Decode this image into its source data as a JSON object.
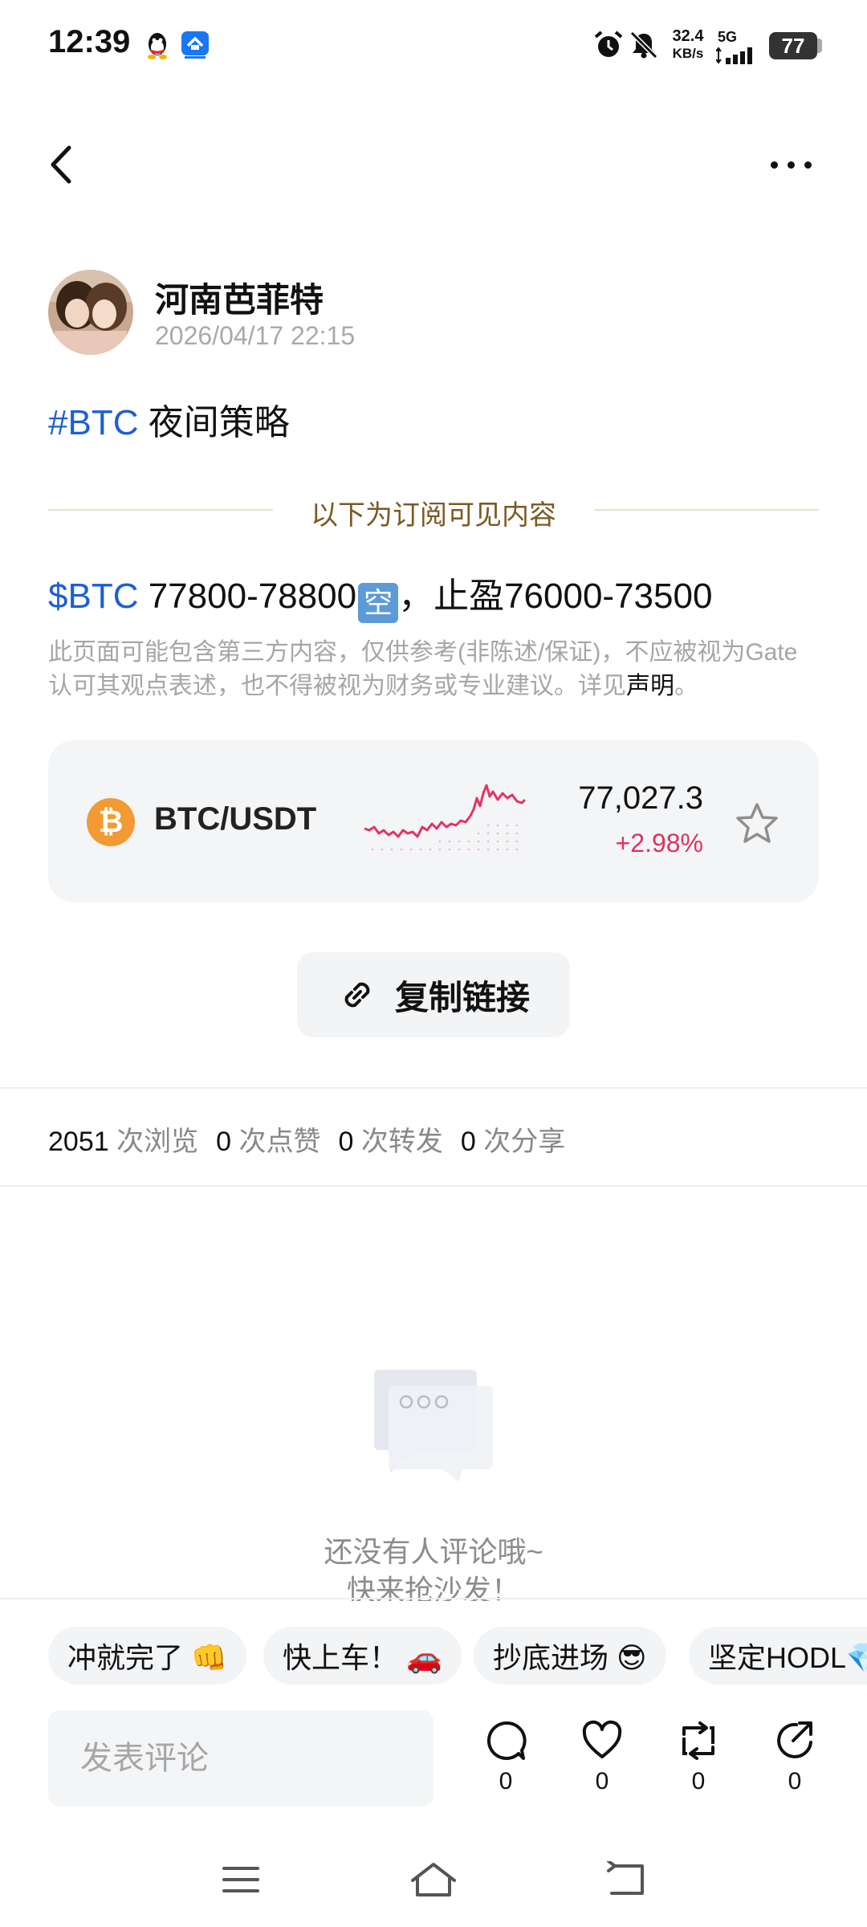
{
  "status_bar": {
    "time": "12:39",
    "net_speed_value": "32.4",
    "net_speed_unit": "KB/s",
    "network": "5G",
    "battery": "77",
    "icons": [
      "qq-icon",
      "app-notification-icon",
      "alarm-icon",
      "mute-icon",
      "signal-icon",
      "battery-icon"
    ]
  },
  "header": {
    "back_icon": "chevron-left-icon",
    "more_icon": "more-horizontal-icon"
  },
  "post": {
    "author": "河南芭菲特",
    "timestamp": "2026/04/17 22:15",
    "title_tag": "#BTC",
    "title_text": " 夜间策略",
    "subscriber_divider": "以下为订阅可见内容",
    "strategy_symbol": "$BTC",
    "strategy_range": " 77800-78800",
    "strategy_badge": "空",
    "strategy_rest": "，止盈76000-73500",
    "disclaimer_text": "此页面可能包含第三方内容，仅供参考(非陈述/保证)，不应被视为Gate认可其观点表述，也不得被视为财务或专业建议。详见",
    "disclaimer_link": "声明",
    "disclaimer_end": "。"
  },
  "ticker": {
    "coin_glyph": "₿",
    "pair": "BTC/USDT",
    "price": "77,027.3",
    "change": "+2.98%",
    "change_color": "#e0325d",
    "accent": "#f39a32"
  },
  "copy_link": {
    "label": "复制链接",
    "icon": "link-icon"
  },
  "stats": {
    "views": "2051",
    "views_label": "次浏览",
    "likes": "0",
    "likes_label": "次点赞",
    "reposts": "0",
    "reposts_label": "次转发",
    "shares": "0",
    "shares_label": "次分享"
  },
  "empty_state": {
    "line1": "还没有人评论哦~",
    "line2": "快来抢沙发！"
  },
  "quick_replies": [
    "冲就完了 👊",
    "快上车！ 🚗",
    "抄底进场 😎",
    "坚定HODL💎"
  ],
  "comment_bar": {
    "placeholder": "发表评论",
    "comment_count": "0",
    "like_count": "0",
    "repost_count": "0",
    "share_count": "0"
  },
  "system_nav": {
    "icons": [
      "menu-icon",
      "home-icon",
      "back-icon"
    ]
  }
}
